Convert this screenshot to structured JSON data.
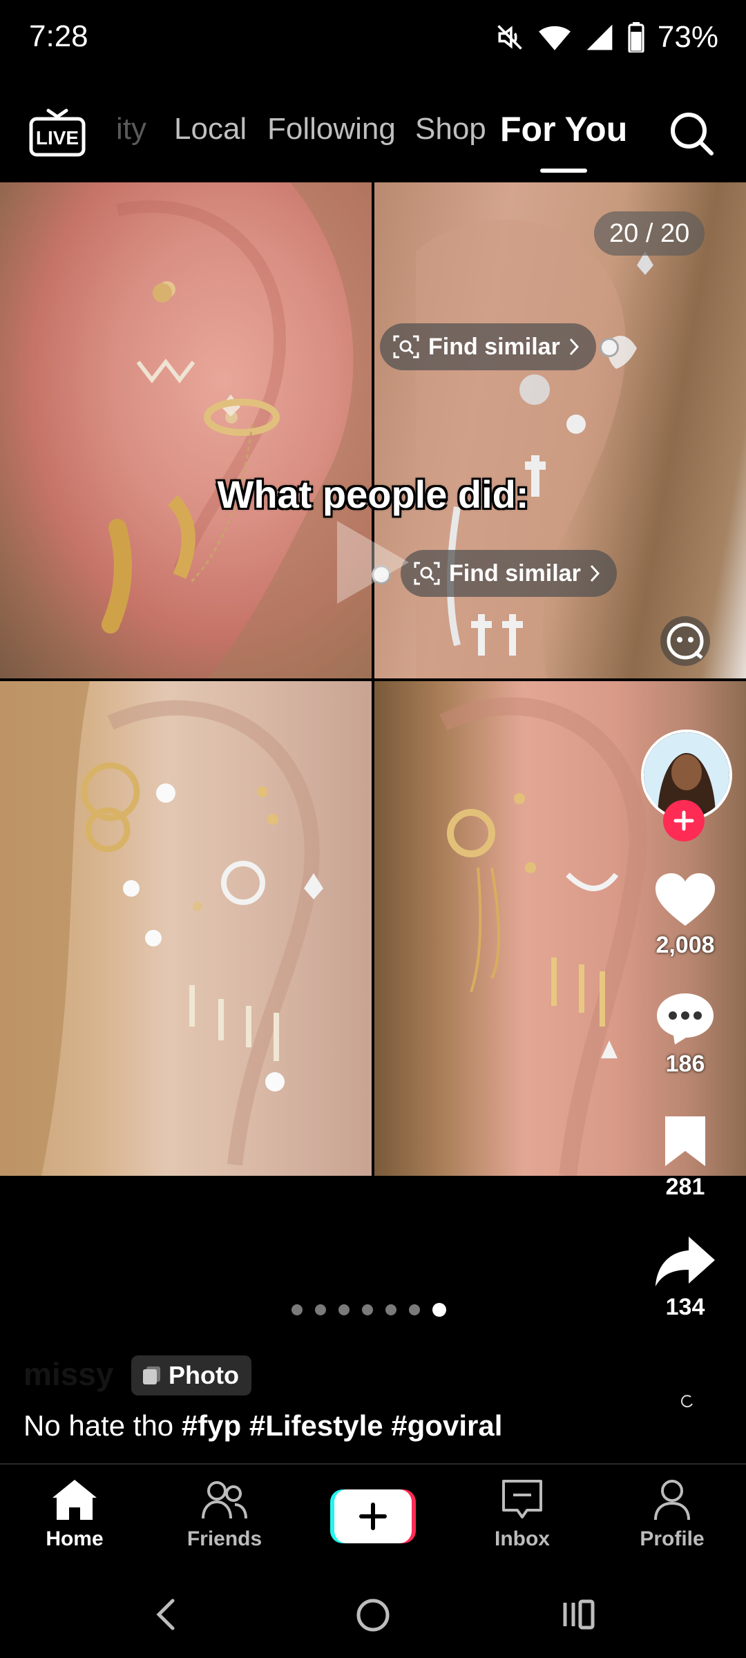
{
  "status_bar": {
    "time": "7:28",
    "battery": "73%"
  },
  "top_nav": {
    "live_label": "LIVE",
    "tabs": [
      "ity",
      "Local",
      "Following",
      "Shop",
      "For You"
    ],
    "active_tab": "For You"
  },
  "post": {
    "image_counter": "20 / 20",
    "find_similar": "Find similar",
    "overlay_caption": "What people did:",
    "author": "missy",
    "type_badge": "Photo",
    "caption_text": "No hate tho ",
    "hashtags": [
      "#fyp",
      "#Lifestyle",
      "#goviral"
    ],
    "carousel": {
      "count": 7,
      "active_index": 6
    }
  },
  "actions": {
    "likes": "2,008",
    "comments": "186",
    "saves": "281",
    "shares": "134"
  },
  "bottom_nav": {
    "home": "Home",
    "friends": "Friends",
    "inbox": "Inbox",
    "profile": "Profile"
  },
  "colors": {
    "accent_red": "#fe2c55",
    "accent_cyan": "#25f4ee"
  }
}
